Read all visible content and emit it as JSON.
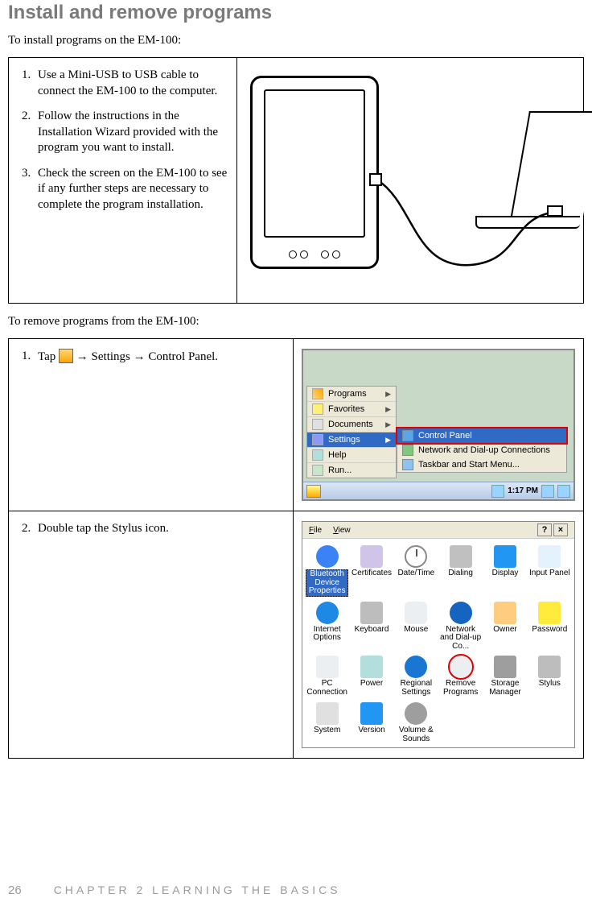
{
  "page": {
    "heading": "Install and remove programs",
    "install_intro": "To install programs on the EM-100:",
    "install_steps": [
      "Use a Mini-USB to USB  cable to connect the EM-100 to the computer.",
      "Follow the instructions in the Installation Wizard provided with the program you want to install.",
      "Check the screen on the EM-100 to see if any further steps are necessary to complete the program installation."
    ],
    "remove_intro": "To remove programs from the EM-100:",
    "remove_step1_prefix": "Tap ",
    "remove_step1_suffix": " → Settings → Control Panel.",
    "remove_step2": "Double tap the Stylus icon.",
    "page_number": "26",
    "chapter": "CHAPTER 2 LEARNING THE BASICS"
  },
  "start_menu": {
    "items": [
      {
        "label": "Programs",
        "arrow": true
      },
      {
        "label": "Favorites",
        "arrow": true
      },
      {
        "label": "Documents",
        "arrow": true
      },
      {
        "label": "Settings",
        "arrow": true,
        "selected": true
      },
      {
        "label": "Help",
        "arrow": false
      },
      {
        "label": "Run...",
        "arrow": false
      }
    ]
  },
  "settings_submenu": {
    "items": [
      {
        "label": "Control Panel",
        "highlighted": true
      },
      {
        "label": "Network and Dial-up Connections",
        "highlighted": false
      },
      {
        "label": "Taskbar and Start Menu...",
        "highlighted": false
      }
    ]
  },
  "taskbar": {
    "time": "1:17 PM"
  },
  "control_panel": {
    "menu": {
      "file": "File",
      "view": "View",
      "help": "?",
      "close": "×"
    },
    "icons": [
      {
        "label": "Bluetooth Device Properties",
        "key": "bluetooth",
        "selected": true
      },
      {
        "label": "Certificates",
        "key": "cert"
      },
      {
        "label": "Date/Time",
        "key": "clock"
      },
      {
        "label": "Dialing",
        "key": "dial"
      },
      {
        "label": "Display",
        "key": "display"
      },
      {
        "label": "Input Panel",
        "key": "input"
      },
      {
        "label": "Internet Options",
        "key": "internet"
      },
      {
        "label": "Keyboard",
        "key": "keyb"
      },
      {
        "label": "Mouse",
        "key": "mouse"
      },
      {
        "label": "Network and Dial-up Co...",
        "key": "netw"
      },
      {
        "label": "Owner",
        "key": "owner"
      },
      {
        "label": "Password",
        "key": "pass"
      },
      {
        "label": "PC Connection",
        "key": "pcconn"
      },
      {
        "label": "Power",
        "key": "power"
      },
      {
        "label": "Regional Settings",
        "key": "regional"
      },
      {
        "label": "Remove Programs",
        "key": "remove",
        "circled": true
      },
      {
        "label": "Storage Manager",
        "key": "storage"
      },
      {
        "label": "Stylus",
        "key": "stylus"
      },
      {
        "label": "System",
        "key": "system"
      },
      {
        "label": "Version",
        "key": "version"
      },
      {
        "label": "Volume & Sounds",
        "key": "volume"
      }
    ]
  }
}
